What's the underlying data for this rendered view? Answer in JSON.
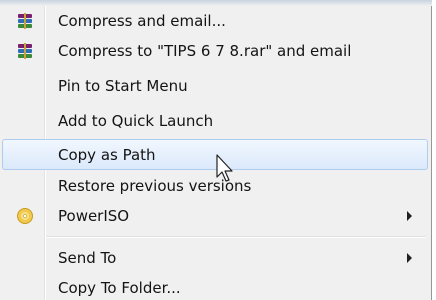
{
  "context_menu": {
    "items": [
      {
        "label": "Compress and email...",
        "icon": "winrar-icon"
      },
      {
        "label": "Compress to \"TIPS 6 7 8.rar\" and email",
        "icon": "winrar-icon"
      },
      {
        "label": "Pin to Start Menu"
      },
      {
        "label": "Add to Quick Launch"
      },
      {
        "label": "Copy as Path",
        "state": "hovered"
      },
      {
        "label": "Restore previous versions"
      },
      {
        "label": "PowerISO",
        "icon": "poweriso-icon",
        "submenu": true
      },
      {
        "label": "Send To",
        "submenu": true
      },
      {
        "label": "Copy To Folder..."
      }
    ]
  },
  "colors": {
    "menu_background": "#f0f0f0",
    "highlight_border": "#aeccee",
    "highlight_fill": "#dbe9fb",
    "text": "#141414"
  }
}
